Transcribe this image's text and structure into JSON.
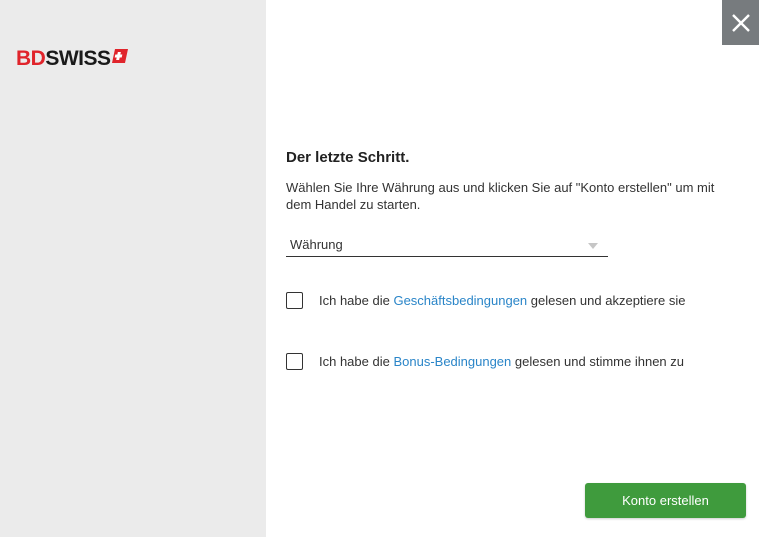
{
  "brand": {
    "part1": "BD",
    "part2": "SWISS",
    "color_red": "#e0242b",
    "color_dark": "#1a1a1a"
  },
  "close": {
    "icon": "close-icon"
  },
  "step": {
    "title": "Der letzte Schritt.",
    "description": "Wählen Sie Ihre Währung aus und klicken Sie auf \"Konto erstellen\" um mit dem Handel zu starten."
  },
  "currency": {
    "placeholder": "Währung",
    "icon": "chevron-down-icon"
  },
  "terms": {
    "prefix": "Ich habe die ",
    "link": "Geschäftsbedingungen",
    "suffix": " gelesen und akzeptiere sie"
  },
  "bonus": {
    "prefix": "Ich habe die ",
    "link": "Bonus-Bedingungen",
    "suffix": " gelesen und stimme ihnen zu"
  },
  "actions": {
    "create_label": "Konto erstellen",
    "create_color": "#3f9b3d"
  },
  "colors": {
    "link": "#2a85c8",
    "left_panel": "#ebebeb",
    "close_bg": "#777b7e"
  }
}
